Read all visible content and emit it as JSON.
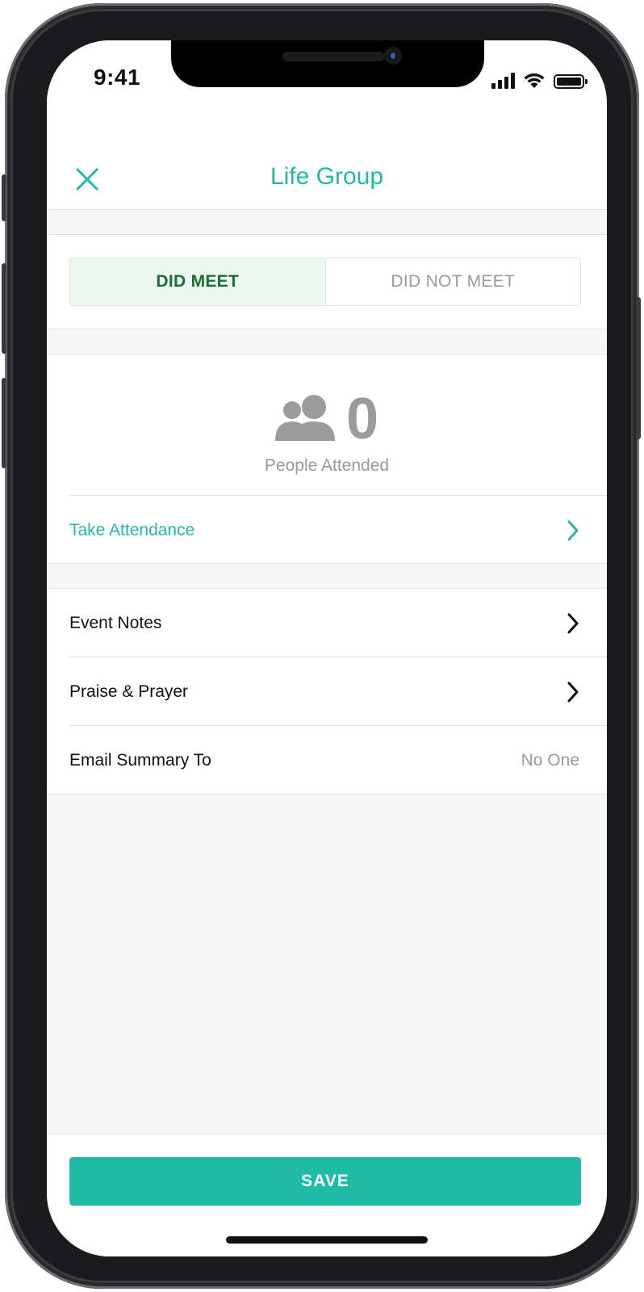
{
  "status_bar": {
    "time": "9:41"
  },
  "nav": {
    "title": "Life Group"
  },
  "meeting_toggle": {
    "options": [
      {
        "label": "DID MEET",
        "selected": true
      },
      {
        "label": "DID NOT MEET",
        "selected": false
      }
    ]
  },
  "attendance": {
    "count": "0",
    "label": "People Attended",
    "take_attendance_label": "Take Attendance"
  },
  "details": {
    "items": [
      {
        "label": "Event Notes"
      },
      {
        "label": "Praise & Prayer"
      },
      {
        "label": "Email Summary To",
        "value": "No One"
      }
    ]
  },
  "footer": {
    "save_label": "SAVE"
  },
  "colors": {
    "accent": "#1fbba6",
    "selected_segment_bg": "#edf9f0",
    "selected_segment_text": "#1f6b3a",
    "muted_text": "#9a9a9a"
  }
}
